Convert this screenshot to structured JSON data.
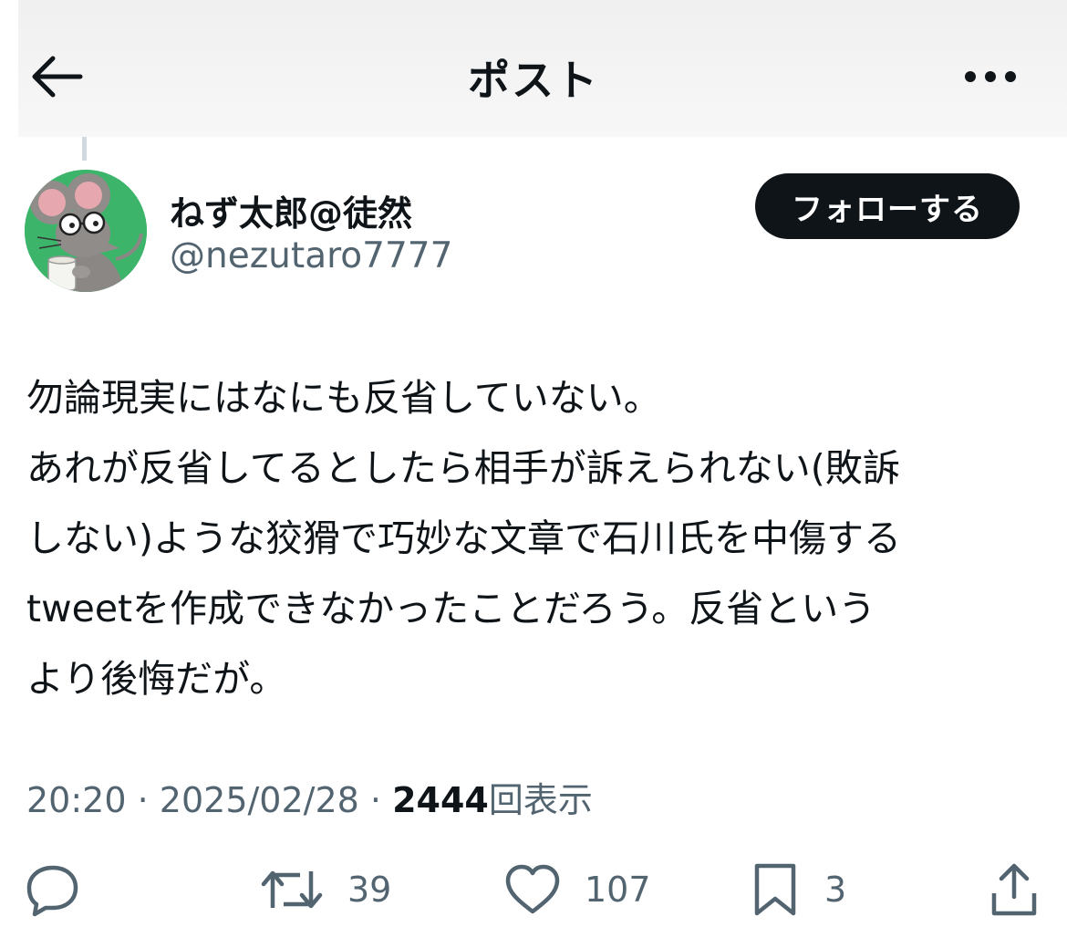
{
  "header": {
    "title": "ポスト",
    "back_icon": "arrow-left-icon",
    "more_icon": "more-horizontal-icon"
  },
  "author": {
    "display_name": "ねず太郎@徒然",
    "handle": "@nezutaro7777",
    "avatar_icon": "mouse-with-glasses-avatar",
    "follow_label": "フォローする"
  },
  "tweet": {
    "text": "勿論現実にはなにも反省していない。\nあれが反省してるとしたら相手が訴えられない(敗訴\nしない)ような狡猾で巧妙な文章で石川氏を中傷する\ntweetを作成できなかったことだろう。反省という\nより後悔だが。"
  },
  "meta": {
    "time": "20:20",
    "separator": "·",
    "date": "2025/02/28",
    "views_count": "2444",
    "views_label": "回表示"
  },
  "actions": {
    "reply_icon": "reply-icon",
    "retweet_icon": "retweet-icon",
    "retweet_count": "39",
    "like_icon": "heart-icon",
    "like_count": "107",
    "bookmark_icon": "bookmark-icon",
    "bookmark_count": "3",
    "share_icon": "share-icon"
  },
  "colors": {
    "text": "#0f1419",
    "secondary_text": "#536471",
    "follow_button_bg": "#0f1419",
    "avatar_bg": "#3cb469"
  }
}
